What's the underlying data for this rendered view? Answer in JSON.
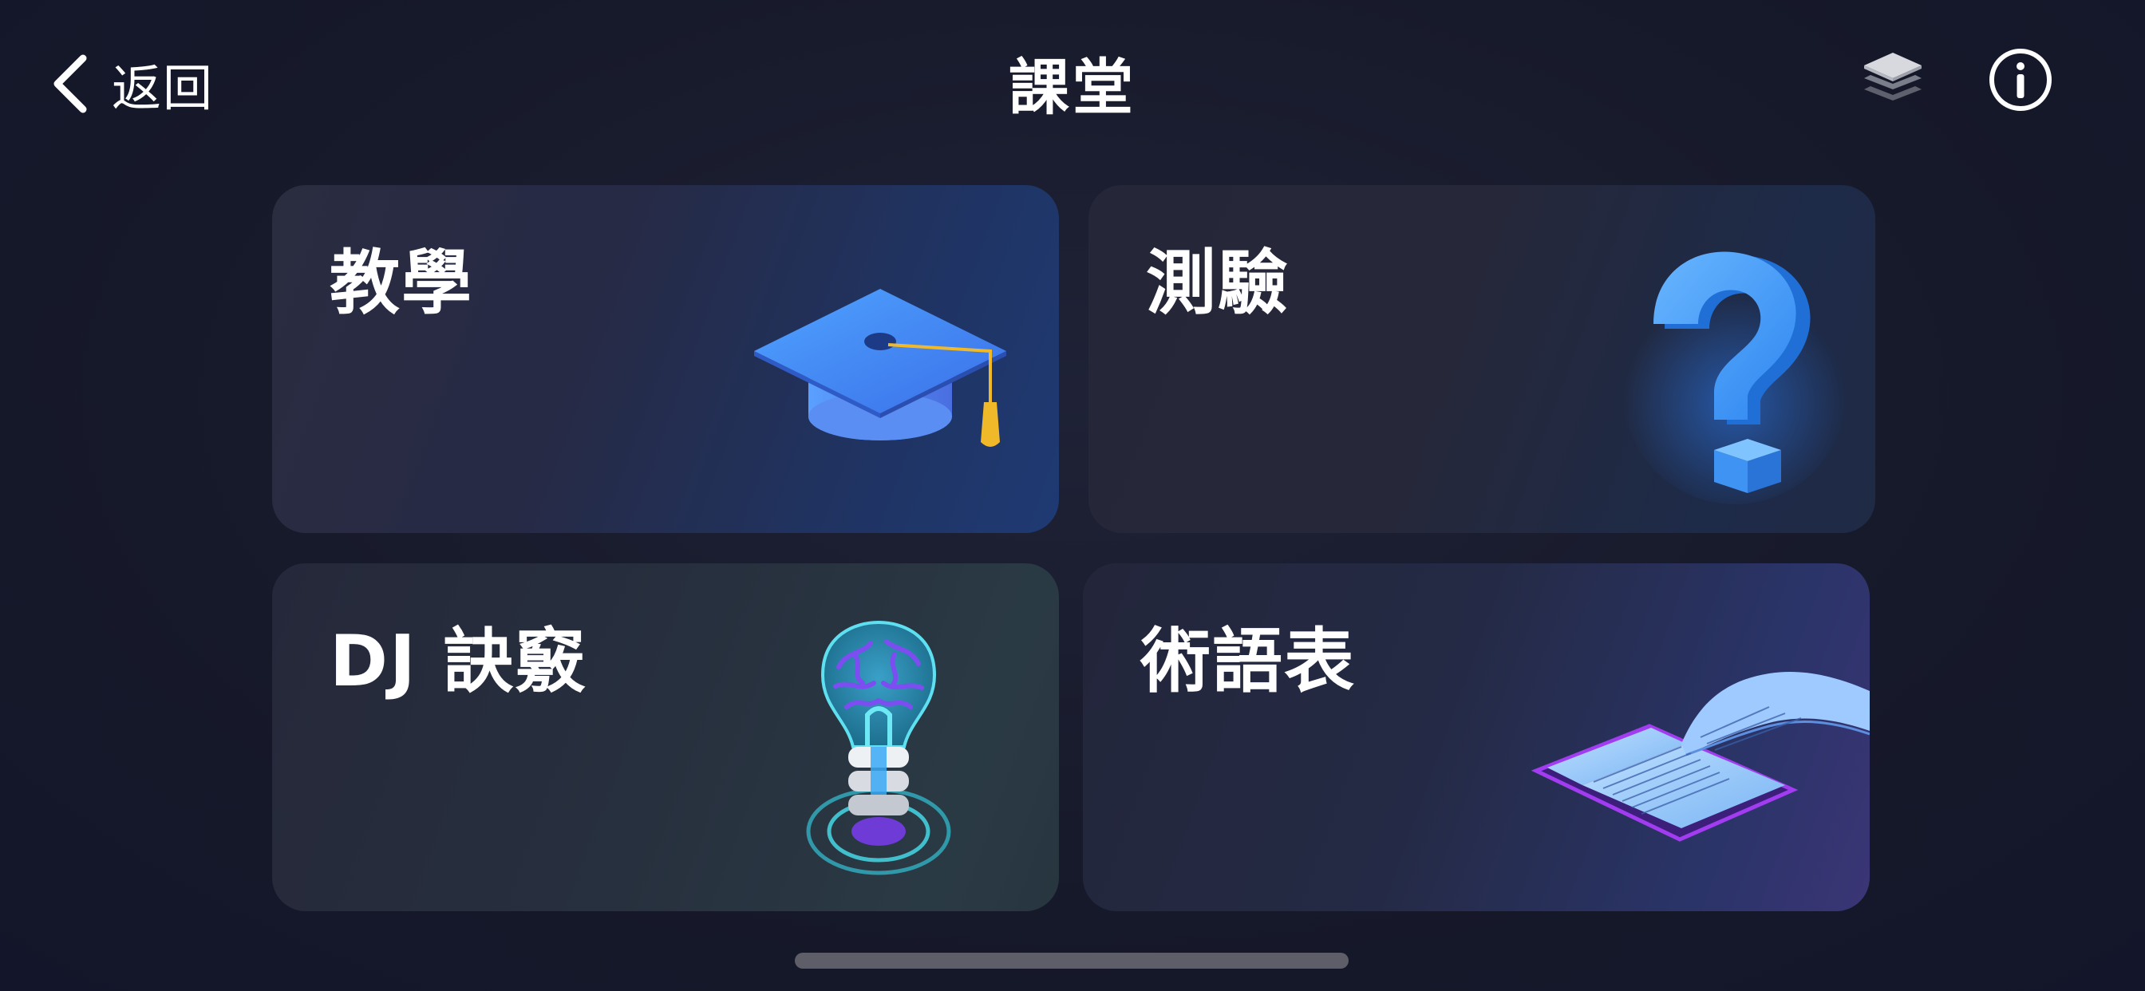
{
  "header": {
    "back_label": "返回",
    "title": "課堂",
    "icons": [
      "layers-icon",
      "info-icon"
    ]
  },
  "cards": [
    {
      "label": "教學",
      "icon": "graduation-cap-icon"
    },
    {
      "label": "測驗",
      "icon": "question-mark-icon"
    },
    {
      "label": "DJ 訣竅",
      "icon": "brain-bulb-icon"
    },
    {
      "label": "術語表",
      "icon": "open-book-icon"
    }
  ],
  "colors": {
    "background": "#171a2b",
    "card": "#262839",
    "accent_blue": "#3f8ef0",
    "accent_gold": "#f0b92a",
    "text": "#ffffff"
  }
}
